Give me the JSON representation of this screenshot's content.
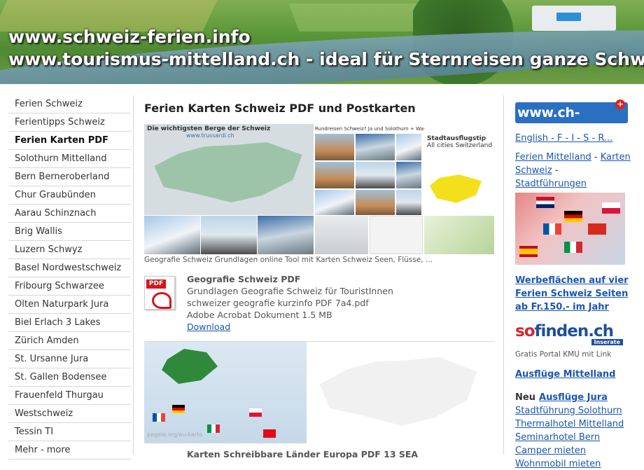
{
  "banner": {
    "line1": "www.schweiz-ferien.info",
    "line2": "www.tourismus-mittelland.ch - ideal für Sternreisen ganze Schweiz"
  },
  "sidebar": {
    "items": [
      {
        "label": "Ferien Schweiz",
        "active": false
      },
      {
        "label": "Ferientipps Schweiz",
        "active": false
      },
      {
        "label": "Ferien Karten PDF",
        "active": true
      },
      {
        "label": "Solothurn Mittelland",
        "active": false
      },
      {
        "label": "Bern Berneroberland",
        "active": false
      },
      {
        "label": "Chur Graubünden",
        "active": false
      },
      {
        "label": "Aarau Schinznach",
        "active": false
      },
      {
        "label": "Brig Wallis",
        "active": false
      },
      {
        "label": "Luzern Schwyz",
        "active": false
      },
      {
        "label": "Basel Nordwestschweiz",
        "active": false
      },
      {
        "label": "Fribourg Schwarzee",
        "active": false
      },
      {
        "label": "Olten Naturpark Jura",
        "active": false
      },
      {
        "label": "Biel Erlach 3 Lakes",
        "active": false
      },
      {
        "label": "Zürich Amden",
        "active": false
      },
      {
        "label": "St. Ursanne Jura",
        "active": false
      },
      {
        "label": "St. Gallen Bodensee",
        "active": false
      },
      {
        "label": "Frauenfeld Thurgau",
        "active": false
      },
      {
        "label": "Westschweiz",
        "active": false
      },
      {
        "label": "Tessin TI",
        "active": false
      },
      {
        "label": "Mehr - more",
        "active": false
      }
    ]
  },
  "main": {
    "title": "Ferien Karten Schweiz PDF und Postkarten",
    "mosaic": {
      "map_title": "Die wichtigsten Berge der Schweiz",
      "map_url": "www.trussardi.ch",
      "stadt_title": "Stadtausflugstip",
      "stadt_sub": "All cities Switzerland",
      "rund_text": "Rundreisen Schweiz? Ja und Solothurn + Waseramt als idealer Ausgangsort!"
    },
    "caption": "Geografie Schweiz Grundlagen online Tool mit Karten Schweiz Seen, Flüsse, ...",
    "pdf": {
      "icon_label": "PDF",
      "title": "Geografie Schweiz PDF",
      "line1": "Grundlagen Geografie Schweiz für TouristInnen",
      "line2": "schweizer geografie kurzinfo PDF 7a4.pdf",
      "line3": "Adobe Acrobat Dokument 1.5 MB",
      "download": "Download"
    },
    "europe_caption": "pegele.org/eu-karte",
    "bottom_text": "Karten Schreibbare Länder Europa PDF 13 SEA"
  },
  "right": {
    "chinfo_logo": "www.ch-info.ch",
    "chinfo_cross": "+",
    "lang_link": "English - F - I - S - R...",
    "ferien_mittelland": "Ferien Mittelland",
    "dash1": " - ",
    "karten_link": "Karten Schweiz",
    "dash2": " - ",
    "stadtfuehrungen": "Stadtführungen",
    "werbe_link": "Werbeflächen auf vier Ferien Schweiz Seiten ab Fr.150.- im Jahr",
    "sofinden_so": "so",
    "sofinden_rest": "finden.ch",
    "sofinden_ins": "Inserate",
    "gratis": "Gratis Portal KMU mit Link",
    "ausfluege_mittelland": "Ausflüge Mittelland",
    "neu": "Neu",
    "ausfluege_jura": "Ausflüge Jura",
    "links": [
      "Stadtführung Solothurn",
      "Thermalhotel Mittelland",
      "Seminarhotel Bern",
      "Camper mieten",
      "Wohnmobil mieten"
    ]
  },
  "colors": {
    "link": "#1a56b0",
    "pdf_red": "#d7141a",
    "chinfo_blue": "#2b6fc0"
  }
}
